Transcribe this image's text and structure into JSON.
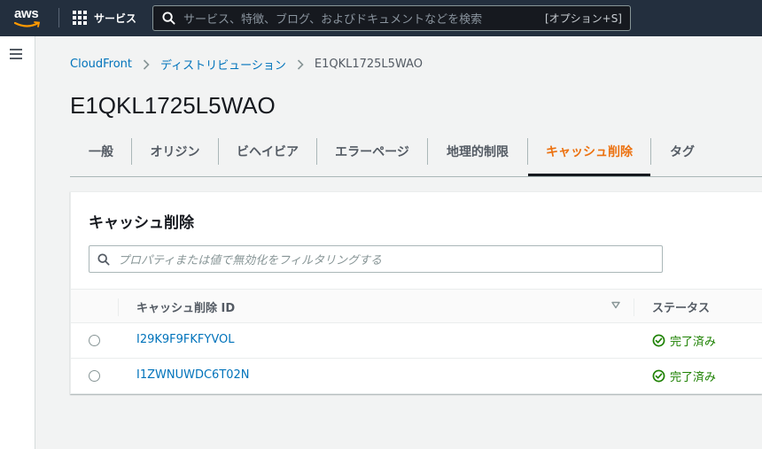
{
  "header": {
    "logo_text": "aws",
    "services_label": "サービス",
    "search_placeholder": "サービス、特徴、ブログ、およびドキュメントなどを検索",
    "search_shortcut": "[オプション+S]"
  },
  "breadcrumb": {
    "items": [
      "CloudFront",
      "ディストリビューション",
      "E1QKL1725L5WAO"
    ]
  },
  "page": {
    "title": "E1QKL1725L5WAO"
  },
  "tabs": [
    {
      "label": "一般",
      "active": false
    },
    {
      "label": "オリジン",
      "active": false
    },
    {
      "label": "ビヘイビア",
      "active": false
    },
    {
      "label": "エラーページ",
      "active": false
    },
    {
      "label": "地理的制限",
      "active": false
    },
    {
      "label": "キャッシュ削除",
      "active": true
    },
    {
      "label": "タグ",
      "active": false
    }
  ],
  "panel": {
    "title": "キャッシュ削除",
    "filter_placeholder": "プロパティまたは値で無効化をフィルタリングする",
    "columns": [
      "キャッシュ削除 ID",
      "ステータス"
    ],
    "rows": [
      {
        "id": "I29K9F9FKFYVOL",
        "status": "完了済み"
      },
      {
        "id": "I1ZWNUWDC6T02N",
        "status": "完了済み"
      }
    ]
  },
  "colors": {
    "topbar": "#232f3e",
    "link": "#0073bb",
    "active_tab": "#ec7211",
    "success": "#1d8102"
  }
}
